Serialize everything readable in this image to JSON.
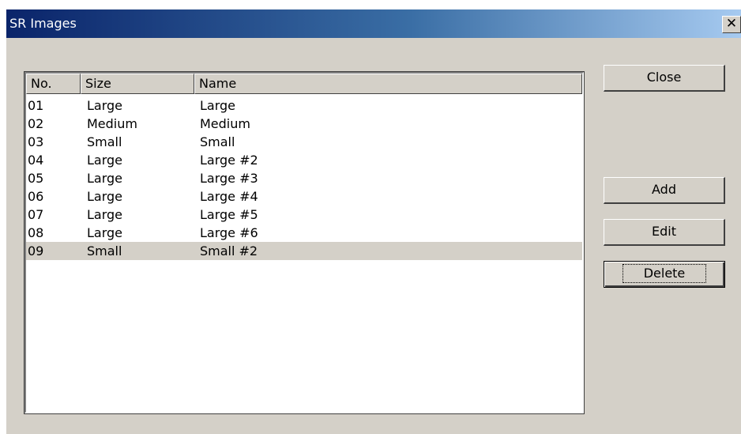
{
  "window": {
    "title": "SR Images",
    "close_glyph": "✕"
  },
  "list": {
    "columns": [
      "No.",
      "Size",
      "Name"
    ],
    "rows": [
      {
        "no": "01",
        "size": "Large",
        "name": "Large"
      },
      {
        "no": "02",
        "size": "Medium",
        "name": "Medium"
      },
      {
        "no": "03",
        "size": "Small",
        "name": "Small"
      },
      {
        "no": "04",
        "size": "Large",
        "name": "Large #2"
      },
      {
        "no": "05",
        "size": "Large",
        "name": "Large #3"
      },
      {
        "no": "06",
        "size": "Large",
        "name": "Large #4"
      },
      {
        "no": "07",
        "size": "Large",
        "name": "Large #5"
      },
      {
        "no": "08",
        "size": "Large",
        "name": "Large #6"
      },
      {
        "no": "09",
        "size": "Small",
        "name": "Small #2"
      }
    ],
    "selected_row": 8
  },
  "buttons": {
    "close": "Close",
    "add": "Add",
    "edit": "Edit",
    "delete": "Delete"
  },
  "colors": {
    "titlebar_start": "#0a246a",
    "titlebar_end": "#a6caf0",
    "face": "#d4d0c8"
  }
}
